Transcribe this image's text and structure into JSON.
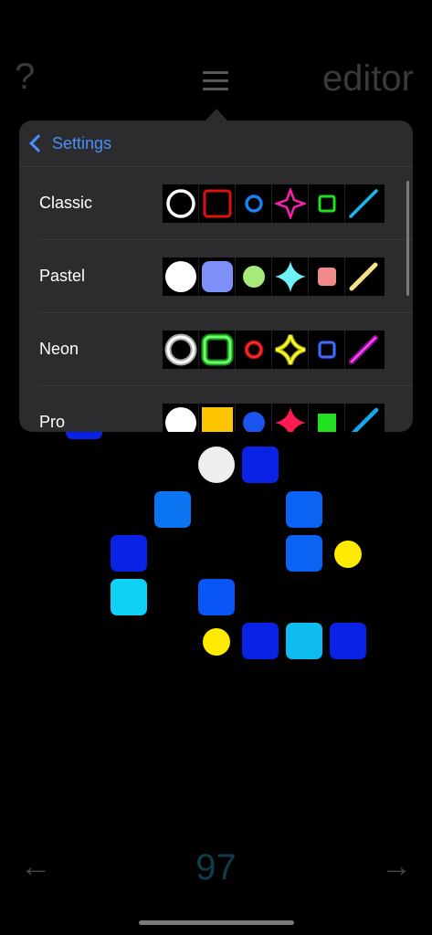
{
  "header": {
    "help_label": "?",
    "mode_label": "editor"
  },
  "popover": {
    "back_label": "Settings",
    "themes": [
      {
        "label": "Classic"
      },
      {
        "label": "Pastel"
      },
      {
        "label": "Neon"
      },
      {
        "label": "Pro"
      }
    ]
  },
  "footer": {
    "prev_label": "←",
    "level_number": "97",
    "next_label": "→"
  },
  "colors": {
    "accent": "#4a8ff8",
    "blue_dark": "#0a22e6",
    "blue_mid": "#0a55f5",
    "blue_light": "#0b8df2",
    "cyan": "#0fbcf0",
    "yellow": "#ffea00",
    "white": "#eeeeee"
  }
}
